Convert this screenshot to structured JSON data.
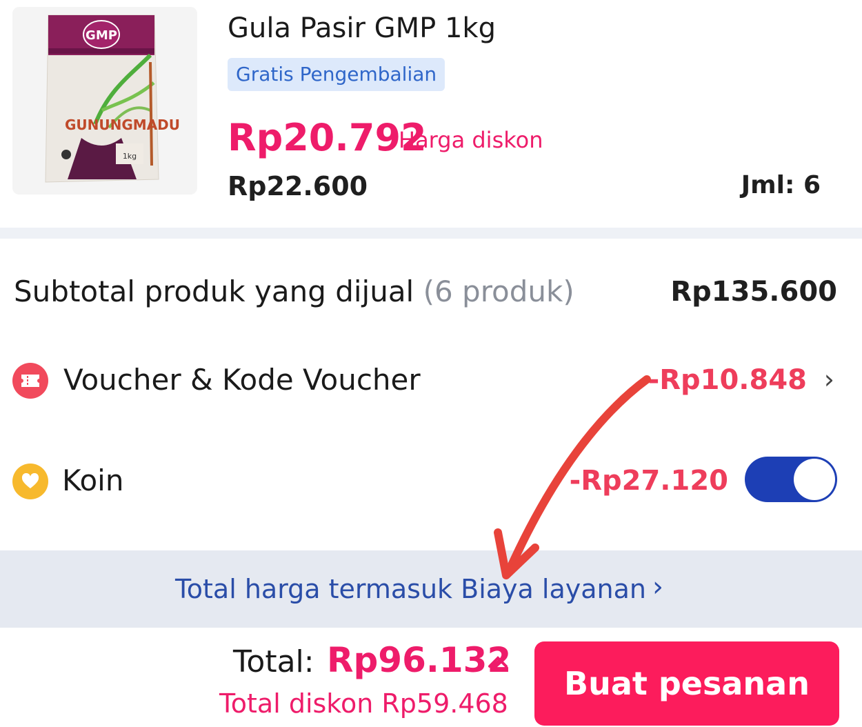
{
  "product": {
    "name": "Gula Pasir GMP 1kg",
    "badge": "Gratis Pengembalian",
    "price": "Rp20.792",
    "price_note": "Harga diskon",
    "original_price": "Rp22.600",
    "quantity": "Jml: 6",
    "image_brand": "GMP",
    "image_text": "GUNUNGMADU",
    "image_weight": "1kg"
  },
  "summary": {
    "subtotal_label": "Subtotal produk yang dijual",
    "subtotal_count": "(6 produk)",
    "subtotal_value": "Rp135.600",
    "voucher_label": "Voucher & Kode Voucher",
    "voucher_value": "-Rp10.848",
    "coin_label": "Koin",
    "coin_value": "-Rp27.120",
    "coin_toggle_on": true
  },
  "info": {
    "text": "Total harga termasuk Biaya layanan"
  },
  "footer": {
    "total_label": "Total:",
    "total_value": "Rp96.132",
    "total_discount": "Total diskon Rp59.468",
    "order_button": "Buat pesanan"
  },
  "colors": {
    "accent": "#ee1c6a",
    "button": "#fc1c5c",
    "toggle": "#1d3fb5",
    "link": "#2a4da8",
    "annotation_arrow": "#e8433a"
  },
  "icons": {
    "voucher": "ticket-icon",
    "coin": "heart-coin-icon",
    "chevron": "chevron-right-icon",
    "expand": "chevron-up-icon"
  }
}
